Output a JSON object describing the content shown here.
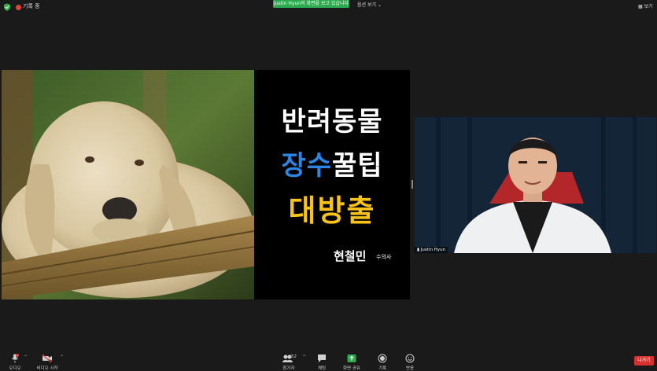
{
  "top_bar": {
    "recording_label": "기록 중",
    "share_banner": "Justin Hyun의 화면을 보고 있습니다",
    "view_options": "옵션 보기 ⌄",
    "view_button": "보기"
  },
  "shared_screen": {
    "title_line1": "반려동물",
    "title_line2_a": "장수",
    "title_line2_b": "꿀팁",
    "title_line3": "대방출",
    "presenter_name": "현철민",
    "presenter_role": "수의사"
  },
  "participant": {
    "name": "Justin Hyun"
  },
  "toolbar": {
    "audio": "오디오",
    "video": "비디오 시작",
    "participants": "참가자",
    "participants_count": "52",
    "chat": "채팅",
    "share": "화면 공유",
    "record": "기록",
    "reactions": "반응",
    "leave": "나가기"
  },
  "colors": {
    "share_green": "#2da94f",
    "leave_red": "#d9302d",
    "title_yellow": "#f7c21a",
    "title_blue": "#2b86e6"
  }
}
